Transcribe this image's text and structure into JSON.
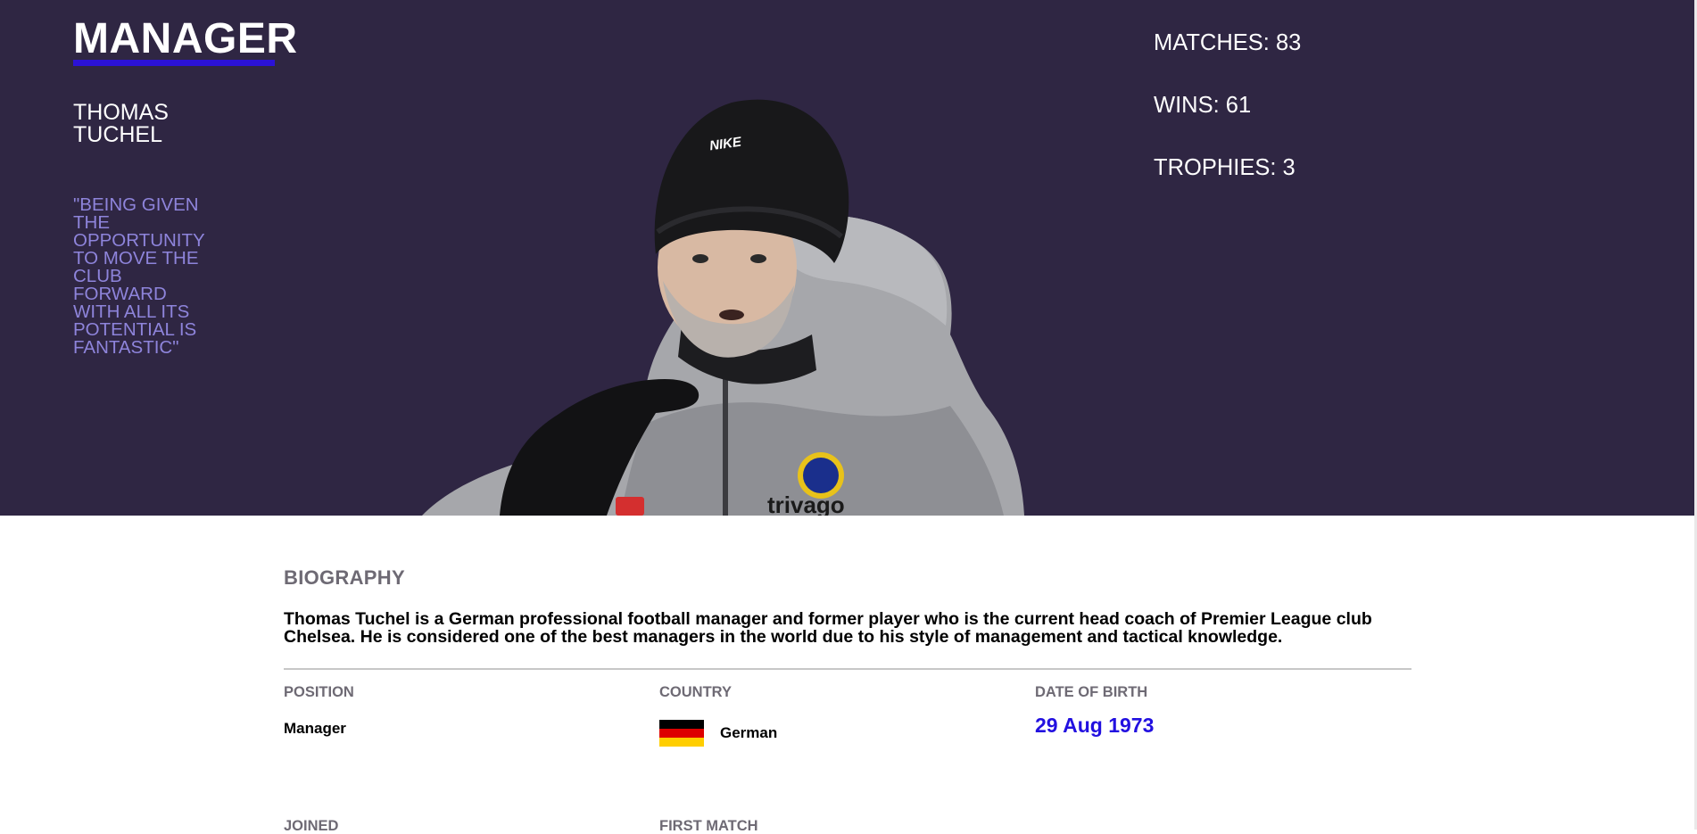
{
  "hero": {
    "title": "MANAGER",
    "name": "THOMAS TUCHEL",
    "quote": "\"BEING GIVEN THE OPPORTUNITY TO MOVE THE CLUB FORWARD WITH ALL ITS POTENTIAL IS FANTASTIC\"",
    "photo_text": {
      "hat_brand": "NIKE",
      "shirt_sponsor": "trivago",
      "crest": "CHELSEA"
    },
    "stats": [
      {
        "label": "MATCHES:",
        "value": "83"
      },
      {
        "label": "WINS:",
        "value": "61"
      },
      {
        "label": "TROPHIES:",
        "value": "3"
      }
    ]
  },
  "details": {
    "section_title": "BIOGRAPHY",
    "bio": "Thomas Tuchel is a German professional football manager and former player who is the current head coach of Premier League club Chelsea. He is considered one of the best managers in the world due to his style of management and tactical knowledge.",
    "fields": [
      {
        "label": "POSITION",
        "value": "Manager"
      },
      {
        "label": "COUNTRY",
        "value": "German",
        "flag": "germany-flag"
      },
      {
        "label": "DATE OF BIRTH",
        "value": "29 Aug 1973"
      },
      {
        "label": "JOINED",
        "value": ""
      },
      {
        "label": "FIRST MATCH",
        "value": ""
      }
    ]
  },
  "colors": {
    "hero_bg": "#2f2643",
    "accent_underline": "#2b12d6",
    "quote": "#8e84db",
    "dob": "#2210e0",
    "label_gray": "#6e6a74"
  }
}
